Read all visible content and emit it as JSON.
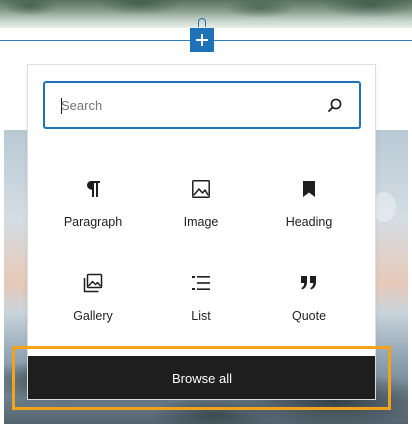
{
  "inserter": {
    "toggle_icon": "plus-icon",
    "accent_color": "#1e72b8"
  },
  "search": {
    "placeholder": "Search",
    "value": "",
    "icon": "search-icon"
  },
  "blocks": [
    {
      "label": "Paragraph",
      "icon": "paragraph-icon"
    },
    {
      "label": "Image",
      "icon": "image-icon"
    },
    {
      "label": "Heading",
      "icon": "heading-icon"
    },
    {
      "label": "Gallery",
      "icon": "gallery-icon"
    },
    {
      "label": "List",
      "icon": "list-icon"
    },
    {
      "label": "Quote",
      "icon": "quote-icon"
    }
  ],
  "browse_all": {
    "label": "Browse all"
  },
  "highlight": {
    "color": "#f5a21b"
  }
}
